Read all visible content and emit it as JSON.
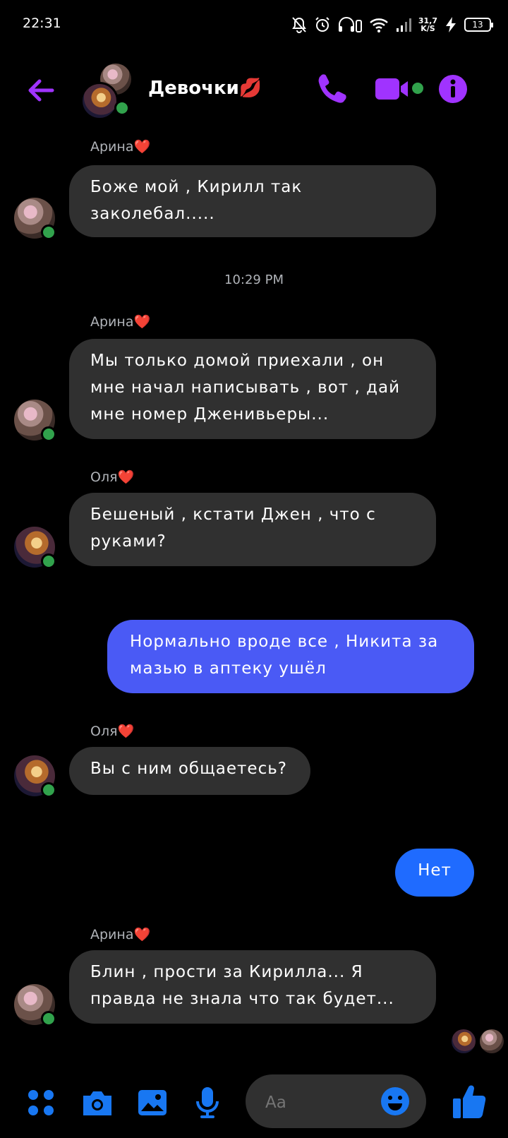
{
  "status_bar": {
    "time": "22:31",
    "net_speed_value": "31,7",
    "net_speed_unit": "K/S",
    "battery": "13"
  },
  "header": {
    "title": "Девочки💋",
    "accent_color": "#a033ff"
  },
  "messages": [
    {
      "sender": "Арина❤️",
      "text": "Боже мой , Кирилл так заколебал....."
    },
    {
      "timestamp": "10:29 PM"
    },
    {
      "sender": "Арина❤️",
      "text": "Мы только домой приехали , он мне начал написывать , вот , дай мне номер Дженивьеры..."
    },
    {
      "sender": "Оля❤️",
      "text": "Бешеный , кстати Джен , что с руками?"
    },
    {
      "outgoing": true,
      "text": "Нормально вроде все , Никита за мазью в аптеку ушёл"
    },
    {
      "sender": "Оля❤️",
      "text": "Вы с ним общаетесь?"
    },
    {
      "outgoing": true,
      "text": "Нет"
    },
    {
      "sender": "Арина❤️",
      "text": "Блин , прости за Кирилла... Я правда не знала что так будет..."
    }
  ],
  "composer": {
    "placeholder": "Aa"
  },
  "icons": {
    "back": "arrow-left-icon",
    "call": "phone-icon",
    "video": "video-camera-icon",
    "info": "info-icon",
    "apps": "grid-dots-icon",
    "camera": "camera-icon",
    "gallery": "image-icon",
    "mic": "microphone-icon",
    "emoji": "smile-icon",
    "like": "thumbs-up-icon"
  },
  "colors": {
    "incoming_bubble": "#303030",
    "outgoing_bubble": "#4a5af5",
    "outgoing_bubble_alt": "#1f6bff",
    "composer_blue": "#1877f2",
    "online": "#31a24c"
  }
}
